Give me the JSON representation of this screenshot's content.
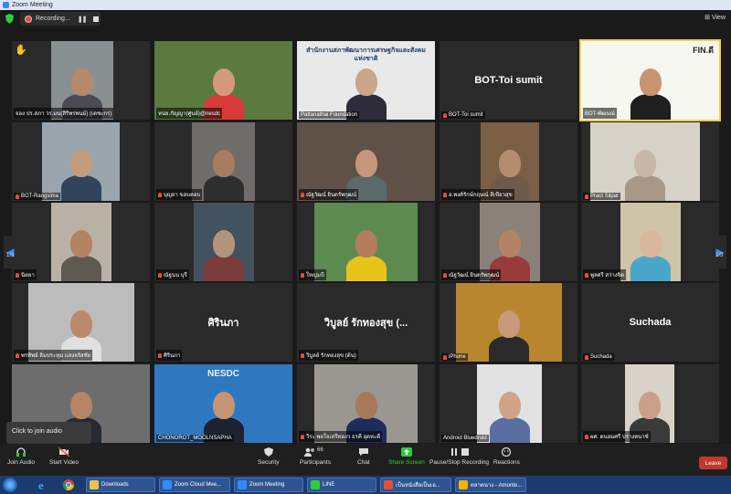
{
  "window": {
    "title": "Zoom Meeting"
  },
  "topbar": {
    "recording_label": "Recording...",
    "pause_glyph": "❚❚",
    "view_label": "View"
  },
  "nav": {
    "left_page": "1/3",
    "right_page": "1/3"
  },
  "participants": [
    {
      "name": "จอง ปร.สภา วร.มน(สิริพรพนม์) (เตชะกร)",
      "muted": false,
      "tile": "room-man"
    },
    {
      "name": "หน่ย.กัญญา(ศูนย์)@nesdc",
      "muted": false,
      "tile": "red-lady"
    },
    {
      "name": "Pattanathai Foundation",
      "muted": false,
      "tile": "conference",
      "banner": "สำนักงานสภาพัฒนาการเศรษฐกิจและสังคมแห่งชาติ"
    },
    {
      "name": "BOT-Toi sumit",
      "muted": true,
      "tile": "name-only",
      "display": "BOT-Toi sumit"
    },
    {
      "name": "BOT-พัฒนณ์",
      "muted": false,
      "tile": "fin-lady",
      "banner": "FIN.ดี"
    },
    {
      "name": "BOT-Rangsima",
      "muted": true,
      "tile": "bridge-lady"
    },
    {
      "name": "บุญยา ขอบคอบ",
      "muted": true,
      "tile": "glasses-man"
    },
    {
      "name": "ณัฐวัฒน์ ยินดรัพกุฒน์",
      "muted": true,
      "tile": "mask-lady"
    },
    {
      "name": "อ.พงศ์รักษ์กฤษณ์ สีเขียวสุข",
      "muted": true,
      "tile": "shelf"
    },
    {
      "name": "Pract Silpat",
      "muted": true,
      "tile": "ceiling"
    },
    {
      "name": "นิตยา",
      "muted": true,
      "tile": "old-lady"
    },
    {
      "name": "ณัฐนน บุรี",
      "muted": true,
      "tile": "partial"
    },
    {
      "name": "ใหญ่มบี",
      "muted": true,
      "tile": "yellow-man"
    },
    {
      "name": "ณัฐวัฒน์ ยินดรัพกุฒน์",
      "muted": true,
      "tile": "window-lady"
    },
    {
      "name": "พูลศรี สว่างจิต",
      "muted": true,
      "tile": "white-hair"
    },
    {
      "name": "พรทิพย์ ลิ่มประทุม แสงจรัสชัย",
      "muted": true,
      "tile": "room-lady"
    },
    {
      "name": "ศิรินภา",
      "muted": true,
      "tile": "name-only",
      "display": "ศิรินภา"
    },
    {
      "name": "วิบูลย์ รักทองสุข (ต้น)",
      "muted": true,
      "tile": "name-only",
      "display": "วิบูลย์ รักทองสุข (..."
    },
    {
      "name": "iPhone",
      "muted": true,
      "tile": "gold-lady"
    },
    {
      "name": "Suchada",
      "muted": true,
      "tile": "name-only",
      "display": "Suchada"
    },
    {
      "name": "",
      "muted": false,
      "tile": "office-man"
    },
    {
      "name": "CHONOROT_MOOLNSAPHA",
      "muted": false,
      "tile": "nesdc-lady",
      "banner": "NESDC"
    },
    {
      "name": "วีระ พอใจเสรีทองว ธรคี อุดหะดี",
      "muted": true,
      "tile": "suit-man"
    },
    {
      "name": "Android Bluedroid",
      "muted": false,
      "tile": "old-man"
    },
    {
      "name": "ผศ. ดนอมศรี ปรางทนาซ์",
      "muted": true,
      "tile": "old-lady2"
    }
  ],
  "toast": {
    "text": "Click to join audio"
  },
  "toolbar": {
    "join_audio": "Join Audio",
    "start_video": "Start Video",
    "security": "Security",
    "participants": "Participants",
    "participants_count": "66",
    "chat": "Chat",
    "share_screen": "Share Screen",
    "pause_recording": "Pause/Stop Recording",
    "reactions": "Reactions",
    "leave": "Leave"
  },
  "taskbar": {
    "tasks": [
      "Downloads",
      "Zoom Cloud Mee...",
      "Zoom Meeting",
      "LINE",
      "เป็นหนังสือเป็นเอ...",
      "ตลาดนาง - Amonte..."
    ]
  },
  "colors": {
    "accent": "#2d8cff",
    "leave": "#c0392b",
    "share": "#2ecc40",
    "record": "#e74c3c"
  }
}
